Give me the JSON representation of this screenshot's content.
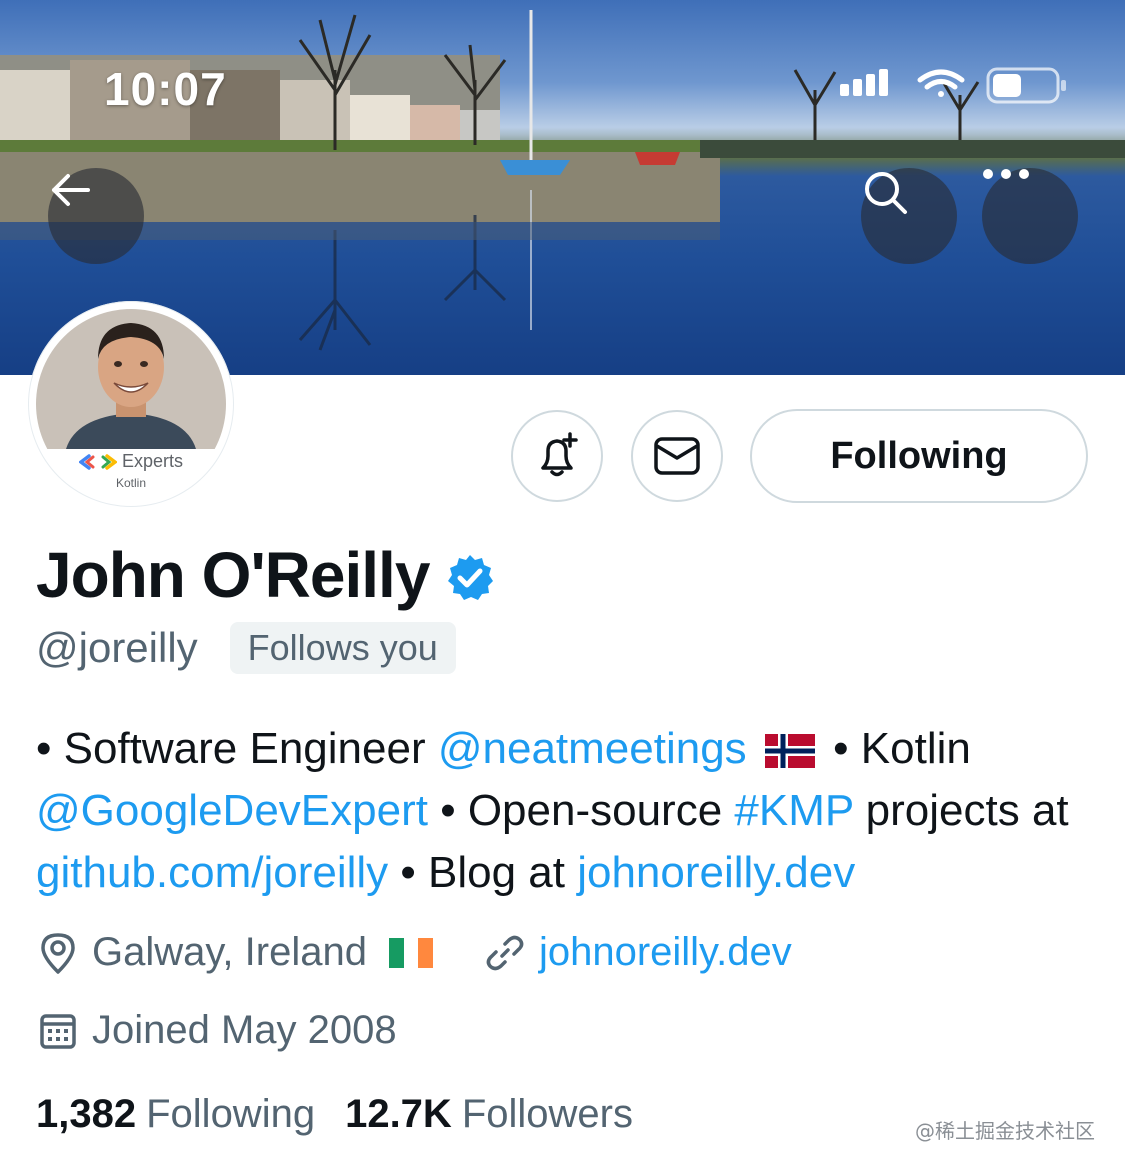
{
  "status_bar": {
    "time": "10:07"
  },
  "profile": {
    "name": "John O'Reilly",
    "handle": "@joreilly",
    "follows_you": "Follows you",
    "following_button": "Following",
    "avatar_badge": {
      "brand": "Experts",
      "sub": "Kotlin"
    }
  },
  "bio": {
    "p1": "• Software Engineer ",
    "mention1": "@neatmeetings",
    "p2": " • Kotlin",
    "mention2": "@GoogleDevExpert",
    "p3": " • Open-source ",
    "hashtag": "#KMP",
    "p4": " projects at ",
    "link1": "github.com/joreilly",
    "p5": " • Blog at ",
    "link2": "johnoreilly.dev"
  },
  "meta": {
    "location": "Galway, Ireland",
    "website": "johnoreilly.dev",
    "joined": "Joined May 2008"
  },
  "stats": {
    "following_count": "1,382",
    "following_label": "Following",
    "followers_count": "12.7K",
    "followers_label": "Followers"
  },
  "watermark": "@稀土掘金技术社区",
  "colors": {
    "accent": "#1d9bf0",
    "text_primary": "#0f1419",
    "text_secondary": "#536471",
    "border": "#cfd9de"
  },
  "icons": [
    "back-arrow-icon",
    "search-icon",
    "more-icon",
    "notification-bell-plus-icon",
    "mail-icon",
    "verified-badge-icon",
    "location-pin-icon",
    "link-icon",
    "calendar-icon",
    "norway-flag-icon",
    "ireland-flag-icon",
    "signal-icon",
    "wifi-icon",
    "battery-icon"
  ]
}
